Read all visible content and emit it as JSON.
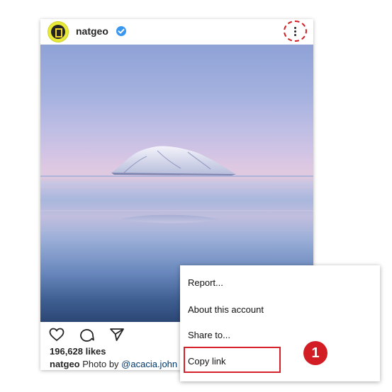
{
  "post": {
    "username": "natgeo",
    "likes": "196,628 likes",
    "caption_user": "natgeo",
    "caption_text": " Photo by ",
    "caption_mention": "@acacia.john",
    "avatar_icon": "natgeo-logo",
    "verified_icon": "verified-badge-icon",
    "more_icon": "more-options-icon",
    "action_icons": [
      "heart-icon",
      "comment-icon",
      "share-icon"
    ],
    "photo_subject": "snow-covered island on calm sea at dusk"
  },
  "menu": {
    "items": [
      "Report...",
      "About this account",
      "Share to...",
      "Copy link"
    ]
  },
  "annotation": {
    "step_number": "1",
    "accent_color": "#d11d23"
  }
}
